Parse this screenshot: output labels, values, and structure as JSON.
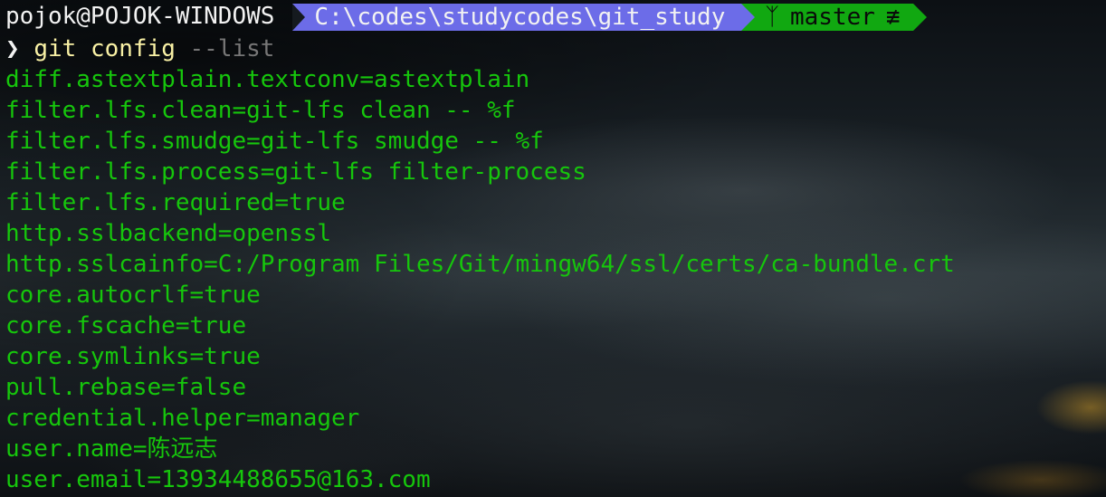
{
  "prompt": {
    "host": "pojok@POJOK-WINDOWS",
    "path": "C:\\codes\\studycodes\\git_study",
    "branch_icon": "git-branch-icon",
    "branch_icon_glyph": "ᛉ",
    "branch": "master",
    "status_icon": "not-equivalent-icon",
    "status_glyph": "≢"
  },
  "command": {
    "chevron": "❯",
    "program": "git",
    "subcommand": "config",
    "flag": "--list"
  },
  "output": [
    "diff.astextplain.textconv=astextplain",
    "filter.lfs.clean=git-lfs clean -- %f",
    "filter.lfs.smudge=git-lfs smudge -- %f",
    "filter.lfs.process=git-lfs filter-process",
    "filter.lfs.required=true",
    "http.sslbackend=openssl",
    "http.sslcainfo=C:/Program Files/Git/mingw64/ssl/certs/ca-bundle.crt",
    "core.autocrlf=true",
    "core.fscache=true",
    "core.symlinks=true",
    "pull.rebase=false",
    "credential.helper=manager",
    "user.name=陈远志",
    "user.email=13934488655@163.com"
  ],
  "colors": {
    "output_text": "#16c60c",
    "path_segment": "#6c6ce8",
    "git_segment": "#11a811",
    "command_keyword": "#f9f1a5",
    "flag": "#767676",
    "host_text": "#f2f2f2"
  }
}
